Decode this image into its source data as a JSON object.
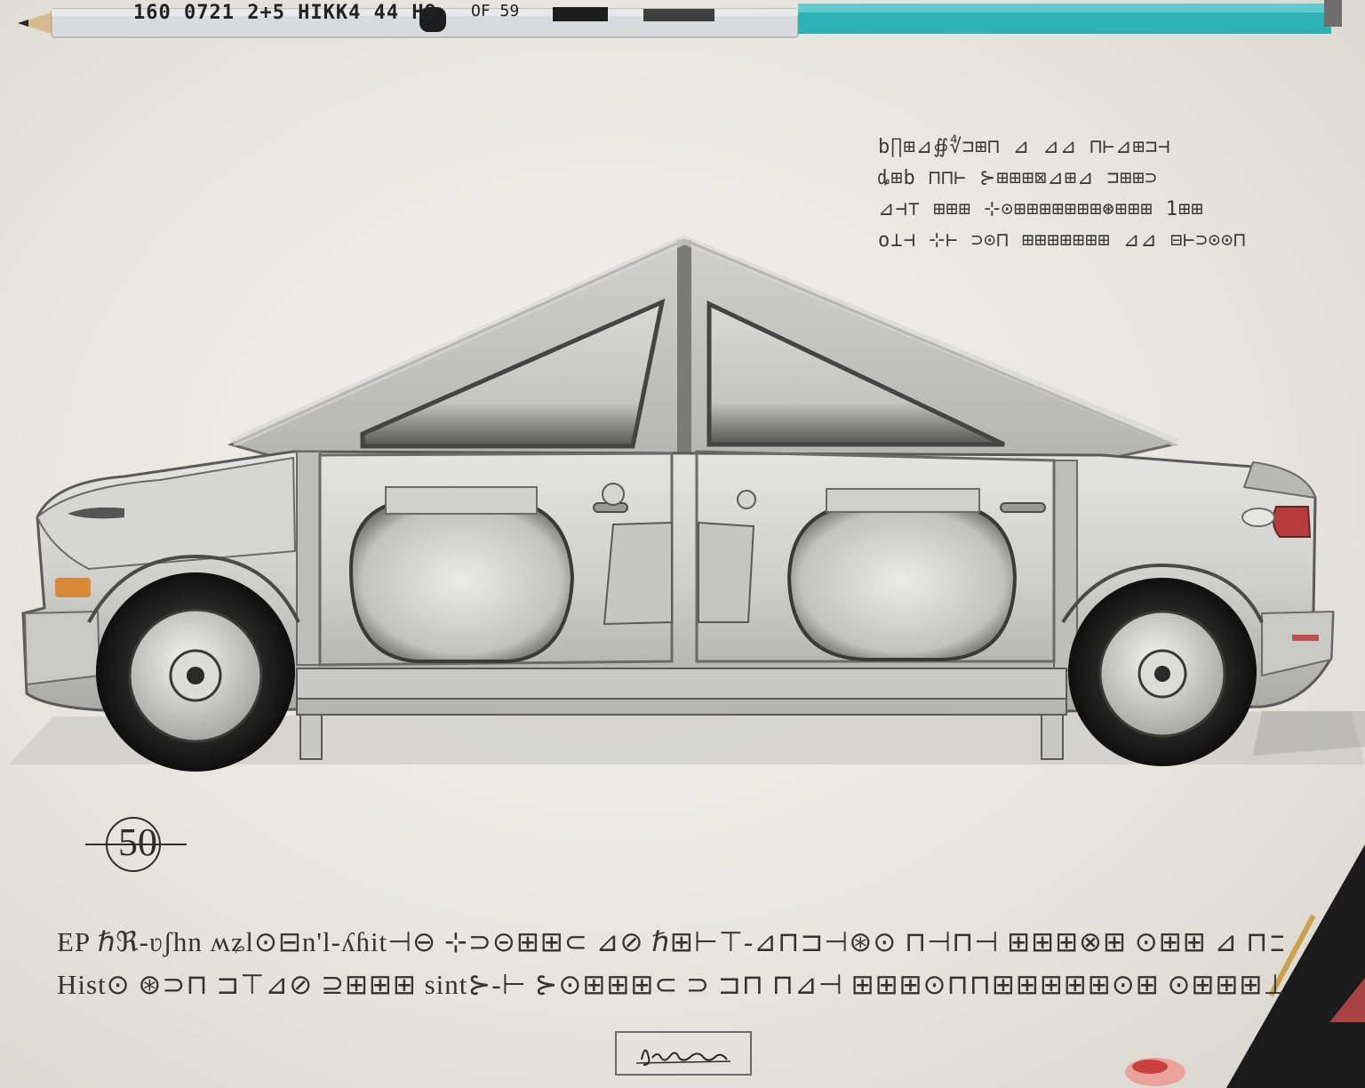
{
  "pencil": {
    "imprint_1": "160 0721 2+5 HIKK4 44 H9",
    "imprint_2": "OF 59"
  },
  "notes": {
    "line_1": "b∏⊞⊿∯∜⊐⊞⊓ ⊿ ⊿⊿ ⊓⊢⊿⊞⊐⊣",
    "line_2": "ȡ⊞b ⊓⊓⊢ ⊱⊞⊞⊞⊠⊿⊞⊿ ⊐⊞⊞⊃",
    "line_3": "⊿⊣⊤ ⊞⊞⊞ ⊹⊙⊞⊞⊞⊞⊞⊞⊞⊛⊞⊞⊞ 1⊞⊞",
    "line_4": "ο⊥⊣ ⊹⊢ ⊃⊙⊓ ⊞⊞⊞⊞⊞⊞⊞ ⊿⊿ ⊟⊢⊃⊙⊙⊓"
  },
  "page_mark": "50",
  "caption": {
    "line_1": "EP ℏℜ-ʋʃhn ʍʑl⊙⊟n'l-ʎɦit⊣⊖ ⊹⊃⊝⊞⊞⊂ ⊿⊘ ℏ⊞⊢⊤-⊿⊓⊐⊣⊛⊙ ⊓⊣⊓⊣ ⊞⊞⊞⊗⊞ ⊙⊞⊞ ⊿ ⊓⊐ ⊞⊣",
    "line_2": "Hist⊙ ⊛⊃⊓ ⊐⊤⊿⊘ ⊇⊞⊞⊞ sint⊱-⊢ ⊱⊙⊞⊞⊞⊂ ⊃ ⊐⊓ ⊓⊿⊣ ⊞⊞⊞⊙⊓⊓⊞⊞⊞⊞⊞⊙⊞ ⊙⊞⊞⊞⊥ ⊃ ⊞⊙⊙⊃ ⊃⊞⊞⊞"
  },
  "signature": "J.Sbhm",
  "colors": {
    "paper": "#eceae4",
    "graphite": "#3a3a3a",
    "pencil_body": "#d9dadb",
    "pencil_accent": "#2eb1b5",
    "taillight": "#b83a3a",
    "indicator": "#d88a3a",
    "pen_body": "#1b1b1b",
    "pen_gold": "#c9a24a"
  }
}
